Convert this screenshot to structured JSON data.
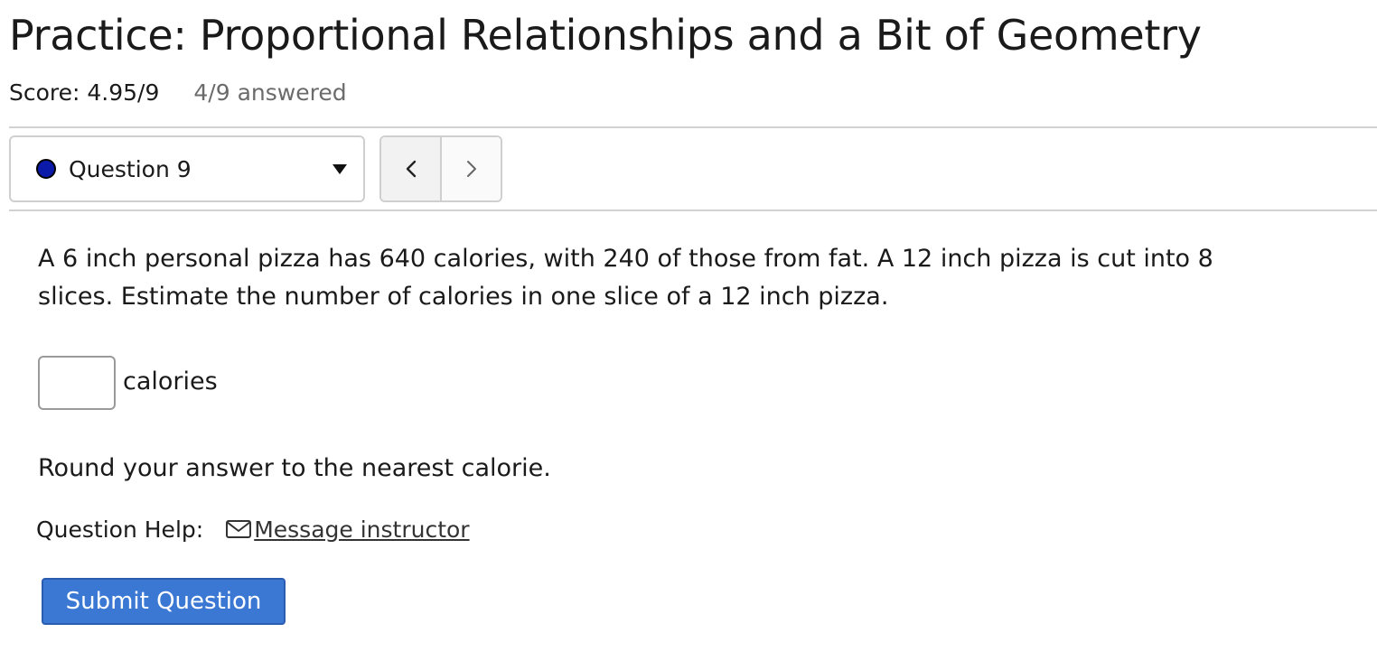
{
  "header": {
    "title": "Practice: Proportional Relationships and a Bit of Geometry",
    "score": "Score: 4.95/9",
    "answered": "4/9 answered"
  },
  "question_nav": {
    "selected_label": "Question 9",
    "status_color": "#0b1aa8",
    "prev_icon": "chevron-left-icon",
    "next_icon": "chevron-right-icon"
  },
  "question": {
    "text": "A 6 inch personal pizza has 640 calories, with 240 of those from fat. A 12 inch pizza is cut into 8 slices. Estimate the number of calories in one slice of a 12 inch pizza.",
    "answer_value": "",
    "unit": "calories",
    "instruction": "Round your answer to the nearest calorie."
  },
  "help": {
    "label": "Question Help:",
    "message_link": "Message instructor",
    "message_icon": "envelope-icon"
  },
  "actions": {
    "submit_label": "Submit Question",
    "submit_color": "#3a78d4"
  }
}
